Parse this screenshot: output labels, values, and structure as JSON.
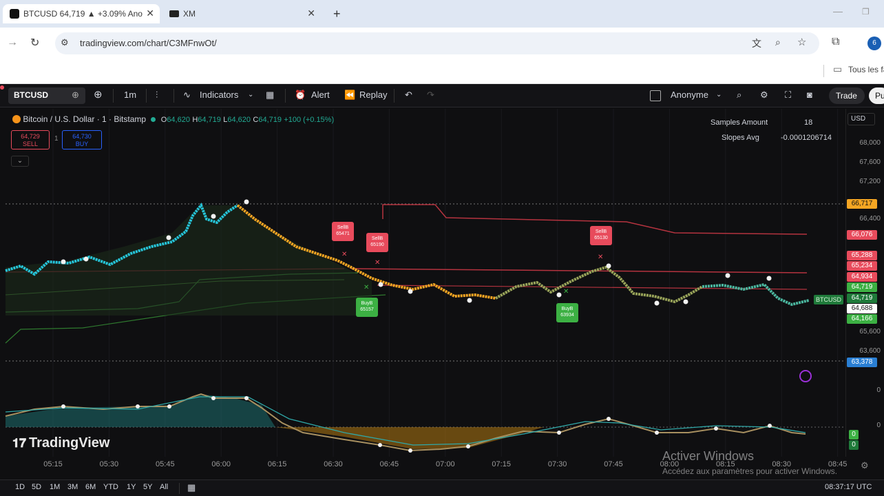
{
  "browser": {
    "tabs": [
      {
        "title": "BTCUSD 64,719 ▲ +3.09% Ano",
        "active": true
      },
      {
        "title": "XM",
        "active": false
      }
    ],
    "new_tab": "+",
    "url": "tradingview.com/chart/C3MFnwOt/",
    "bookmark": "Tous les fa",
    "profile_initial": "6"
  },
  "toolbar": {
    "symbol": "BTCUSD",
    "interval": "1m",
    "indicators": "Indicators",
    "alert": "Alert",
    "replay": "Replay",
    "layout": "Anonyme",
    "trade": "Trade",
    "publish": "Pu"
  },
  "legend": {
    "title": "Bitcoin / U.S. Dollar · 1 · Bitstamp",
    "o_label": "O",
    "o": "64,620",
    "h_label": "H",
    "h": "64,719",
    "l_label": "L",
    "l": "64,620",
    "c_label": "C",
    "c": "64,719",
    "change": "+100 (+0.15%)",
    "sell_price": "64,729",
    "sell_label": "SELL",
    "buy_price": "64,730",
    "buy_label": "BUY"
  },
  "stats": {
    "samples_label": "Samples Amount",
    "samples_value": "18",
    "slopes_label": "Slopes Avg",
    "slopes_value": "-0.0001206714"
  },
  "signals": [
    {
      "label": "SellB",
      "price": "65471"
    },
    {
      "label": "SellB",
      "price": "65190"
    },
    {
      "label": "BuyB",
      "price": "65157"
    },
    {
      "label": "SellB",
      "price": "65130"
    },
    {
      "label": "BuyB",
      "price": "63934"
    }
  ],
  "symbol_tag": "BTCUSD",
  "price_axis": {
    "currency": "USD",
    "labels": [
      "68,000",
      "67,600",
      "67,200",
      "66,400",
      "65,600",
      "63,600",
      "0",
      "0"
    ],
    "tags": [
      {
        "text": "66,717",
        "color": "#f5a623"
      },
      {
        "text": "66,076",
        "color": "#e84b5c"
      },
      {
        "text": "65,288",
        "color": "#e84b5c"
      },
      {
        "text": "65,234",
        "color": "#e84b5c"
      },
      {
        "text": "64,934",
        "color": "#e84b5c"
      },
      {
        "text": "64,719",
        "color": "#3cb043"
      },
      {
        "text": "64,719",
        "color": "#1f7a3a"
      },
      {
        "text": "64,688",
        "color": "#ffffff"
      },
      {
        "text": "64,166",
        "color": "#3cb043"
      },
      {
        "text": "63,378",
        "color": "#2a7fd4"
      },
      {
        "text": "0",
        "color": "#3cb043"
      },
      {
        "text": "0",
        "color": "#1f7a3a"
      }
    ]
  },
  "time_axis": [
    "05:15",
    "05:30",
    "05:45",
    "06:00",
    "06:15",
    "06:30",
    "06:45",
    "07:00",
    "07:15",
    "07:30",
    "07:45",
    "08:00",
    "08:15",
    "08:30",
    "08:45"
  ],
  "bottom": {
    "ranges": [
      "1D",
      "5D",
      "1M",
      "3M",
      "6M",
      "YTD",
      "1Y",
      "5Y",
      "All"
    ],
    "clock": "08:37:17 UTC"
  },
  "watermark": "TradingView",
  "windows_activation": {
    "title": "Activer Windows",
    "subtitle": "Accédez aux paramètres pour activer Windows."
  },
  "colors": {
    "bull": "#26c6da",
    "bear": "#f5a623",
    "neutral": "#9aa55a",
    "sell": "#e84b5c",
    "buy": "#3cb043"
  }
}
